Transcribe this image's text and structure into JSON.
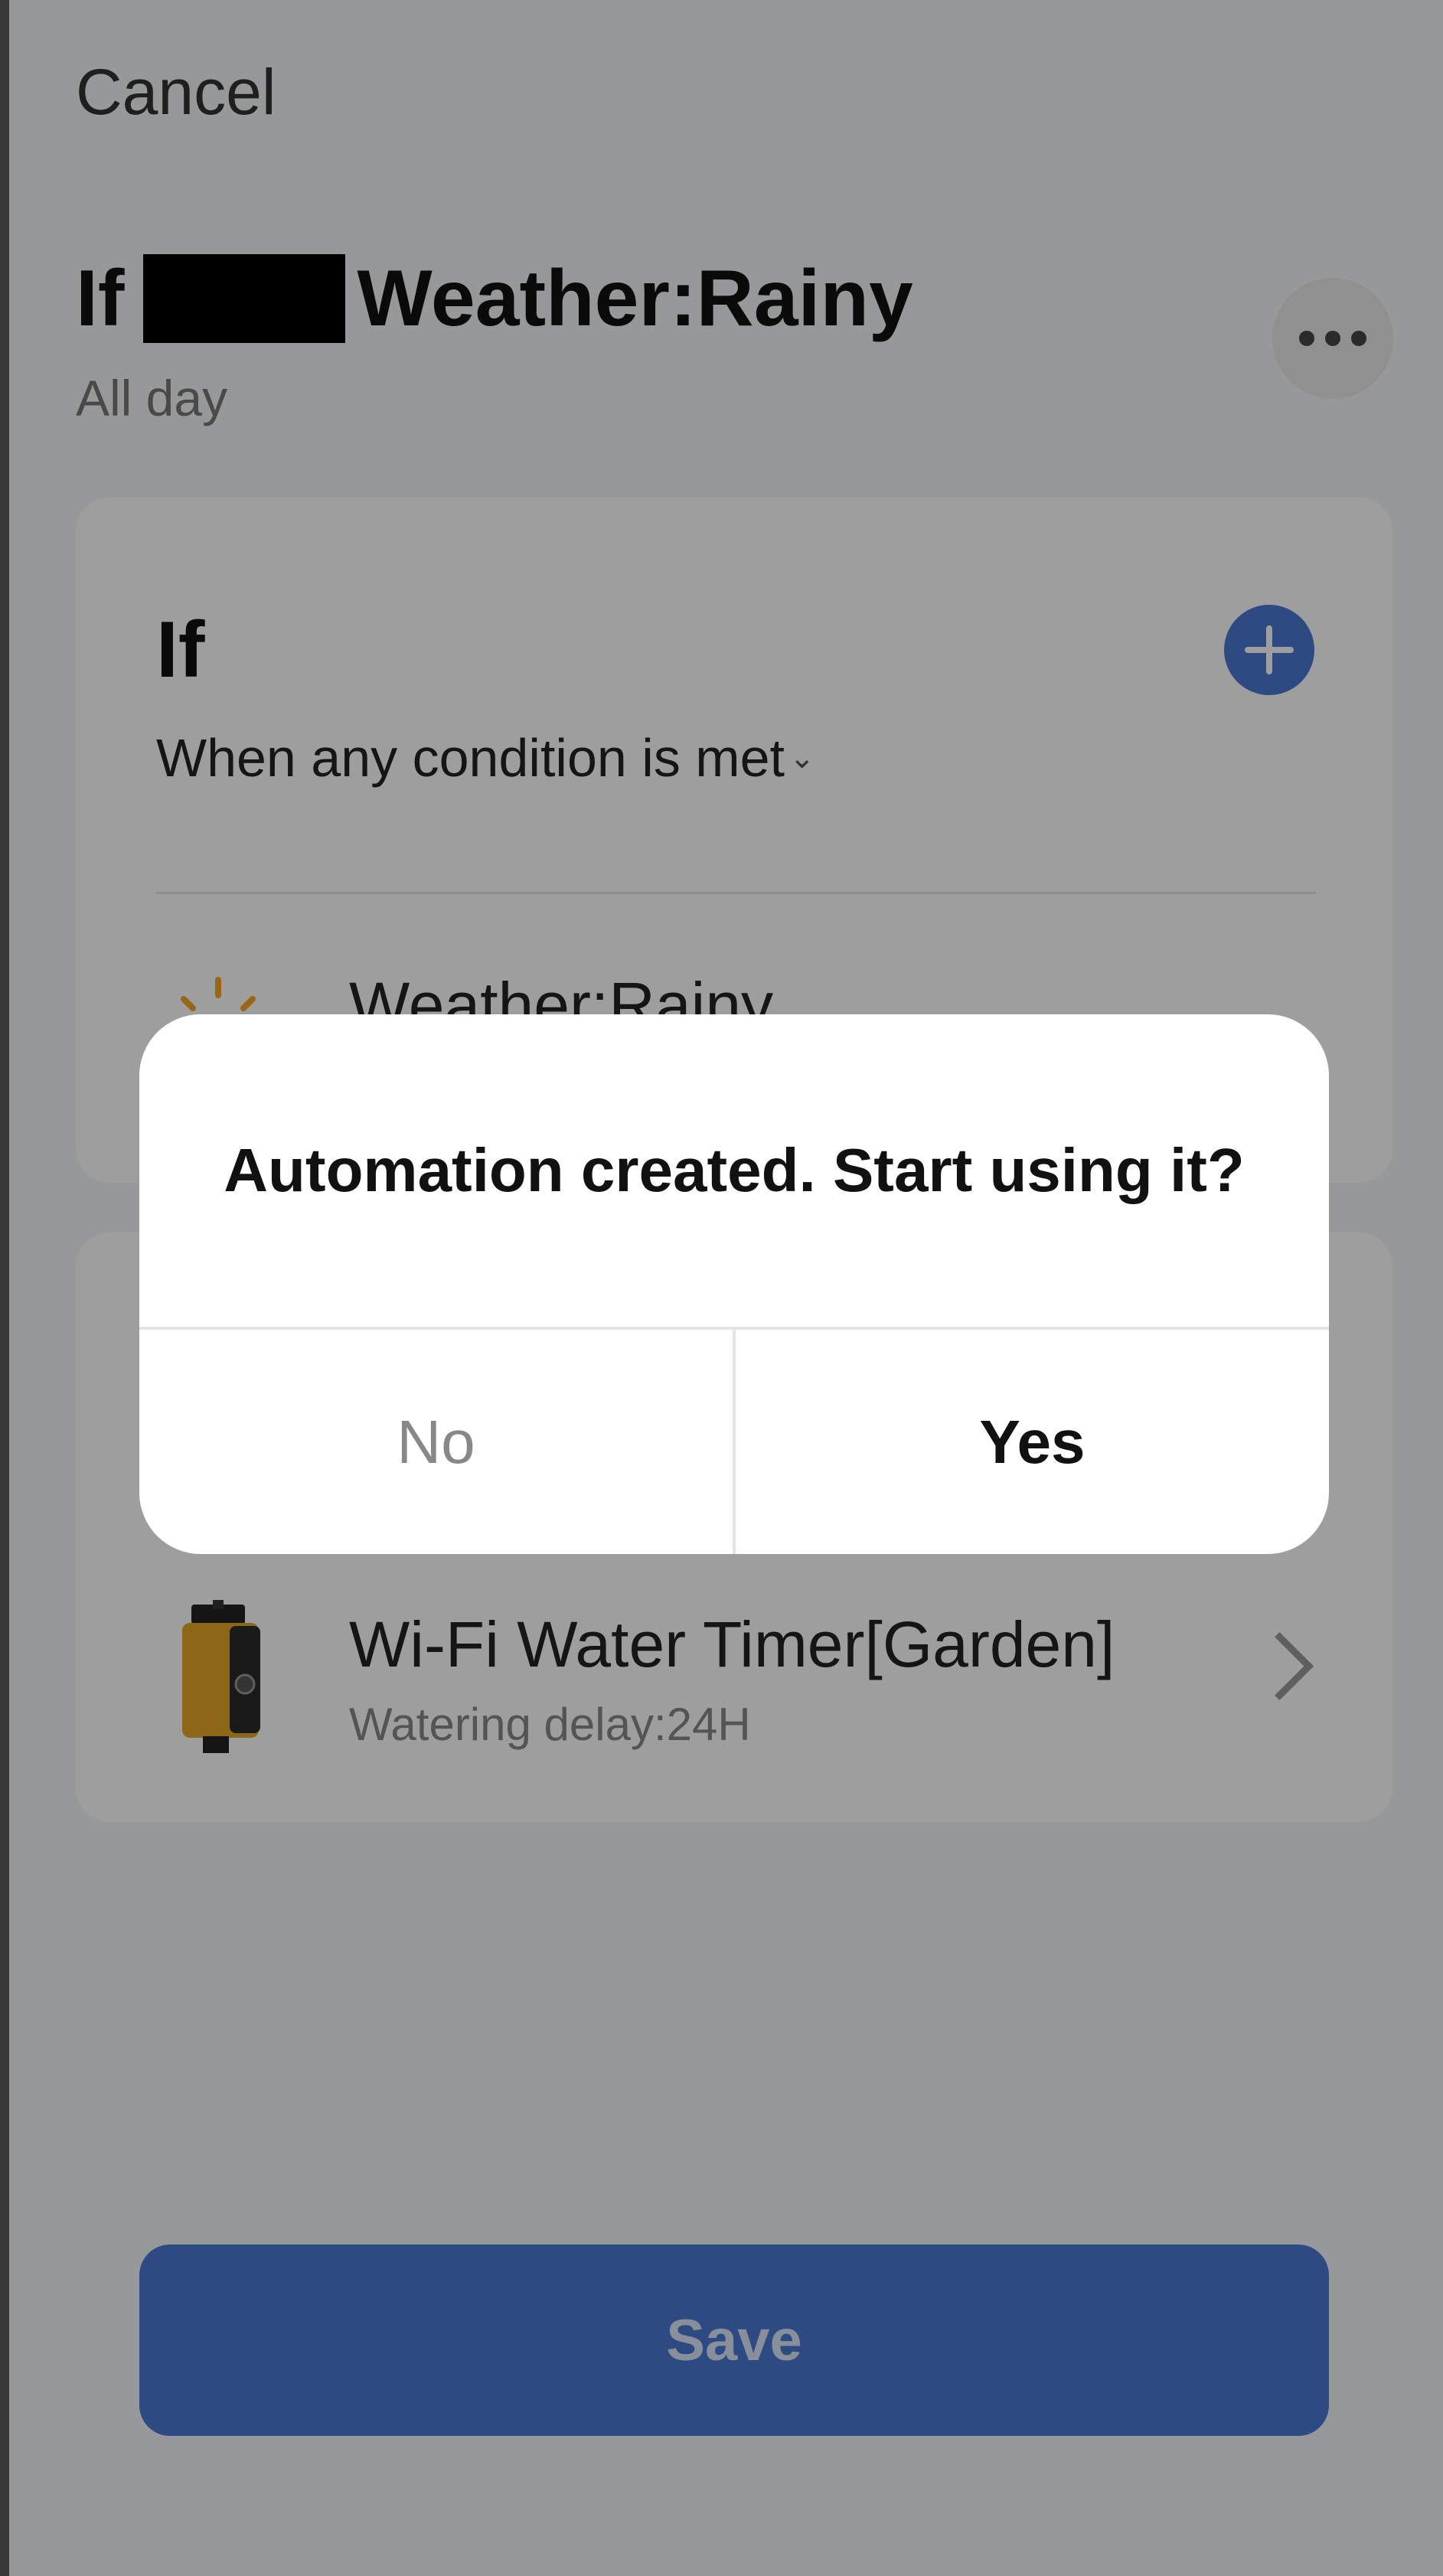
{
  "header": {
    "cancel_label": "Cancel",
    "title_prefix": "If",
    "title_condition": "Weather:Rainy",
    "subtitle": "All day"
  },
  "if_card": {
    "heading": "If",
    "condition_mode": "When any condition is met",
    "conditions": [
      {
        "label": "Weather:Rainy",
        "icon": "sun-icon"
      }
    ]
  },
  "actions": [
    {
      "title": "Wi-Fi Water Timer[Garden]",
      "subtitle": "Watering delay:24H",
      "icon": "water-timer-device-image"
    }
  ],
  "save_label": "Save",
  "dialog": {
    "message": "Automation created. Start using it?",
    "no_label": "No",
    "yes_label": "Yes"
  },
  "colors": {
    "accent": "#4a78d4",
    "overlay": "rgba(0,0,0,0.38)"
  }
}
